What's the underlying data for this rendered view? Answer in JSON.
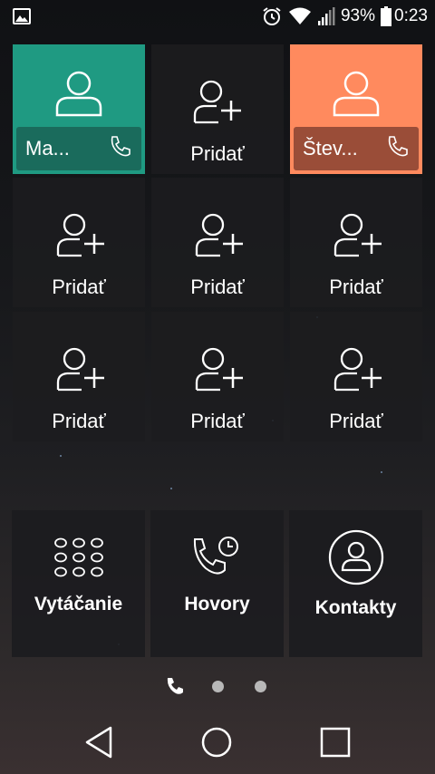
{
  "status_bar": {
    "battery_percent": "93%",
    "time": "0:23",
    "icons": [
      "image-icon",
      "alarm-icon",
      "wifi-icon",
      "signal-icon",
      "battery-icon"
    ]
  },
  "speed_dial": {
    "contacts": [
      {
        "name": "Ma...",
        "color": "#1f9a82",
        "bar_color": "#1a6b5c"
      },
      {
        "name": "Štev...",
        "color": "#ff8a5e",
        "bar_color": "#9a4d38"
      }
    ],
    "add_label": "Pridať"
  },
  "main_buttons": {
    "dialer": "Vytáčanie",
    "calls": "Hovory",
    "contacts": "Kontakty"
  },
  "pager": {
    "pages": 3,
    "current": 1
  },
  "nav": {
    "icons": [
      "back-icon",
      "home-icon",
      "recents-icon"
    ]
  }
}
